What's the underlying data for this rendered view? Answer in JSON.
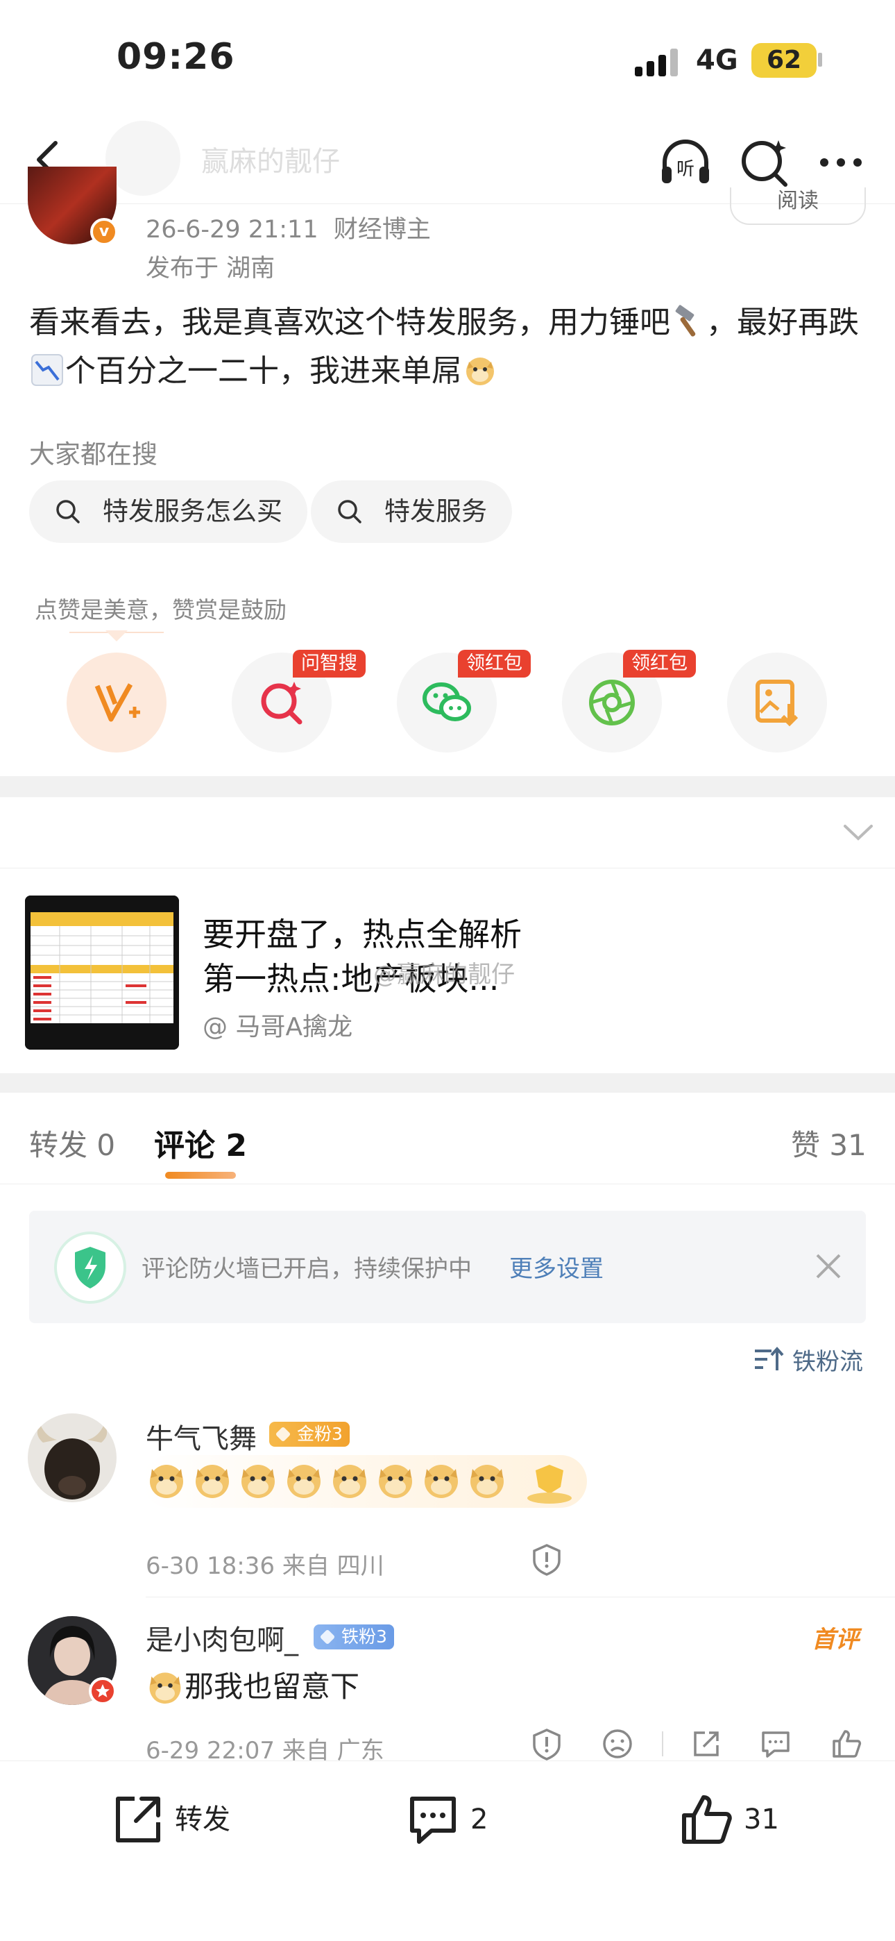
{
  "status": {
    "time": "09:26",
    "network": "4G",
    "battery": "62"
  },
  "header": {
    "name": "赢麻的靓仔",
    "listen_label": "听"
  },
  "post": {
    "date": "26-6-29 21:11",
    "role": "财经博主",
    "location": "发布于 湖南",
    "follow_label": "阅读",
    "text_a": "看来看去，我是真喜欢这个特发服务，用力锤吧",
    "text_b": "，最好再跌",
    "text_c": "个百分之一二十，我进来单屌"
  },
  "search": {
    "title": "大家都在搜",
    "chips": [
      "特发服务怎么买",
      "特发服务"
    ]
  },
  "reward": {
    "tip": "点赞是美意，赞赏是鼓励",
    "tags": [
      "问智搜",
      "领红包",
      "领红包"
    ]
  },
  "card": {
    "title1": "要开盘了，热点全解析",
    "title2": "第一热点:地产板块...",
    "source": "@ 马哥A擒龙",
    "watermark": "@赢麻的靓仔"
  },
  "tabs": {
    "repost": "转发 0",
    "comment": "评论 2",
    "like": "赞 31"
  },
  "firewall": {
    "text": "评论防火墙已开启，持续保护中",
    "link": "更多设置"
  },
  "sort_label": "铁粉流",
  "comments": [
    {
      "name": "牛气飞舞",
      "badge": "金粉3",
      "time": "6-30 18:36  来自 四川"
    },
    {
      "name": "是小肉包啊_",
      "badge": "铁粉3",
      "text": "那我也留意下",
      "time": "6-29 22:07  来自 广东",
      "first_tag": "首评"
    }
  ],
  "bottom": {
    "repost": "转发",
    "comment": "2",
    "like": "31"
  },
  "colors": {
    "accent": "#f08a21",
    "red_tag": "#e9412f",
    "link": "#4e7fb8"
  }
}
